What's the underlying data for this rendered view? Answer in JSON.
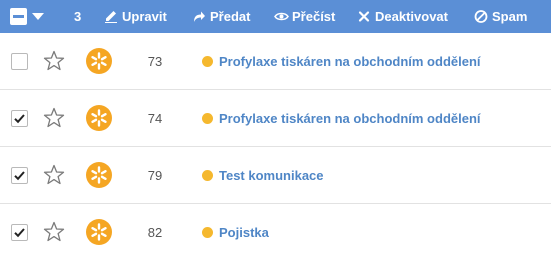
{
  "toolbar": {
    "selected_count": "3",
    "buttons": [
      {
        "label": "Upravit",
        "icon": "pencil-icon"
      },
      {
        "label": "Předat",
        "icon": "forward-arrow-icon"
      },
      {
        "label": "Přečíst",
        "icon": "eye-icon"
      },
      {
        "label": "Deaktivovat",
        "icon": "close-icon"
      },
      {
        "label": "Spam",
        "icon": "block-icon"
      }
    ],
    "bg_color": "#5b8fd6"
  },
  "rows": [
    {
      "checked": false,
      "id": "73",
      "subject": "Profylaxe tiskáren na obchodním oddělení",
      "status_color": "#f5b82e"
    },
    {
      "checked": true,
      "id": "74",
      "subject": "Profylaxe tiskáren na obchodním oddělení",
      "status_color": "#f5b82e"
    },
    {
      "checked": true,
      "id": "79",
      "subject": "Test komunikace",
      "status_color": "#f5b82e"
    },
    {
      "checked": true,
      "id": "82",
      "subject": "Pojistka",
      "status_color": "#f5b82e"
    }
  ],
  "colors": {
    "avatar": "#f5a623",
    "link": "#4f86c6"
  }
}
